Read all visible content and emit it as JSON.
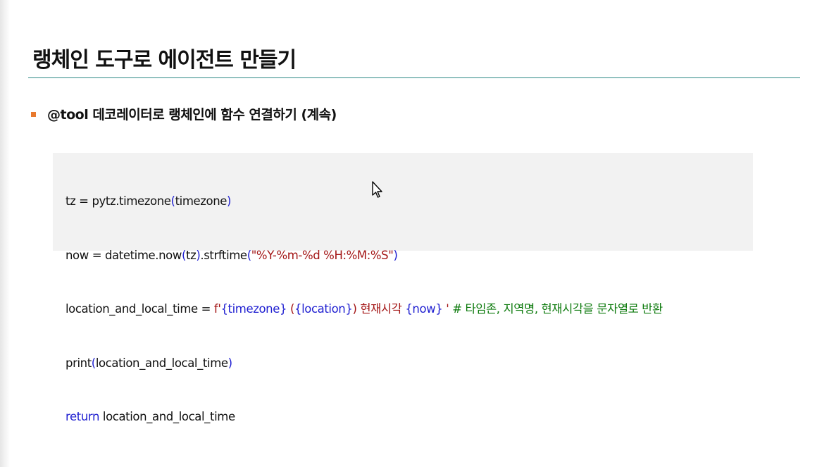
{
  "slide": {
    "title": "랭체인 도구로 에이전트 만들기",
    "bullet": "@tool 데코레이터로 랭체인에 함수 연결하기 (계속)"
  },
  "code": {
    "line1": {
      "a": "tz = pytz.timezone",
      "b": "(",
      "c": "timezone",
      "d": ")"
    },
    "line2": {
      "a": "now = datetime.now",
      "b": "(",
      "c": "tz",
      "d": ")",
      "e": ".strftime",
      "f": "(",
      "g": "\"%Y-%m-%d %H:%M:%S\"",
      "h": ")"
    },
    "line3": {
      "a": "location_and_local_time = ",
      "b": "f'",
      "c": "{timezone}",
      "d": " (",
      "e": "{location}",
      "f": ") 현재시각 ",
      "g": "{now}",
      "h": " ' ",
      "i": "# 타임존, 지역명, 현재시각을 문자열로 반환"
    },
    "line4": {
      "a": "print",
      "b": "(",
      "c": "location_and_local_time",
      "d": ")"
    },
    "line5": {
      "a": "return",
      "b": " location_and_local_time"
    }
  },
  "colors": {
    "accent_rule": "#2f8a86",
    "bullet": "#e8792e",
    "keyword": "#1f1fd1",
    "string": "#a31515",
    "comment": "#0c7a0c"
  },
  "icons": {
    "cursor": "mouse-pointer-icon"
  }
}
